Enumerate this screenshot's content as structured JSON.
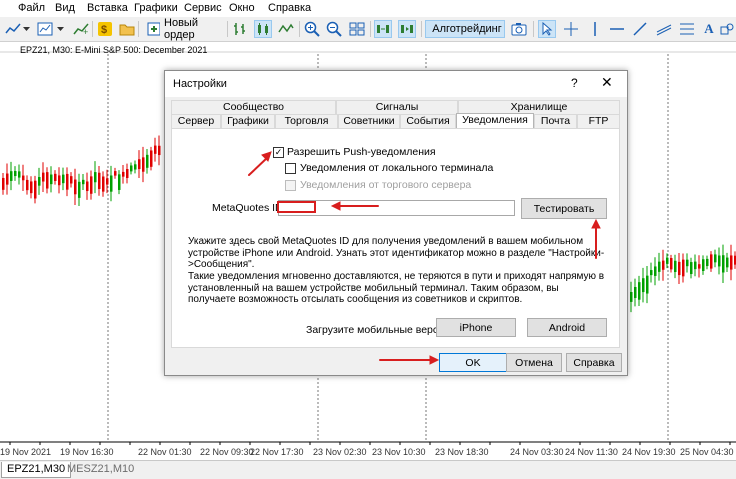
{
  "menu": [
    "Файл",
    "Вид",
    "Вставка",
    "Графики",
    "Сервис",
    "Окно",
    "Справка"
  ],
  "toolbar": {
    "new_order": "Новый ордер",
    "algotrading": "Алготрейдинг"
  },
  "chart": {
    "title": "EPZ21, M30:  E-Mini S&P 500: December 2021",
    "up_color": "#00a000",
    "down_color": "#e00000",
    "x_labels": [
      "19 Nov 2021",
      "19 Nov 16:30",
      "22 Nov 01:30",
      "22 Nov 09:30",
      "22 Nov 17:30",
      "23 Nov 02:30",
      "23 Nov 10:30",
      "23 Nov 18:30",
      "24 Nov 03:30",
      "24 Nov 11:30",
      "24 Nov 19:30",
      "25 Nov 04:30"
    ]
  },
  "bottom_tabs": [
    "EPZ21,M30",
    "MESZ21,M10"
  ],
  "dialog": {
    "title": "Настройки",
    "help_glyph": "?",
    "close_glyph": "✕",
    "tabs_row1": [
      "Сообщество",
      "Сигналы",
      "Хранилище"
    ],
    "tabs_row2": [
      "Сервер",
      "Графики",
      "Торговля",
      "Советники",
      "События",
      "Уведомления",
      "Почта",
      "FTP"
    ],
    "active_tab": "Уведомления",
    "push_enabled_label": "Разрешить Push-уведомления",
    "push_enabled": true,
    "local_terminal_label": "Уведомления от локального терминала",
    "trade_server_label": "Уведомления от торгового сервера",
    "metaquotes_id_label": "MetaQuotes ID:",
    "metaquotes_id_value": "",
    "test_button": "Тестировать",
    "info_text_1": "Укажите здесь свой MetaQuotes ID для получения уведомлений в вашем мобильном устройстве iPhone или Android. Узнать этот идентификатор можно в разделе \"Настройки->Сообщения\".",
    "info_text_2": "Такие уведомления мгновенно доставляются, не теряются в пути и приходят напрямую в установленный на вашем устройстве мобильный терминал. Таким образом, вы получаете возможность отсылать сообщения из советников и скриптов.",
    "download_label": "Загрузите мобильные версии для:",
    "iphone_button": "iPhone",
    "android_button": "Android",
    "ok_button": "OK",
    "cancel_button": "Отмена",
    "help_button": "Справка"
  },
  "annotation_color": "#d81e1e"
}
